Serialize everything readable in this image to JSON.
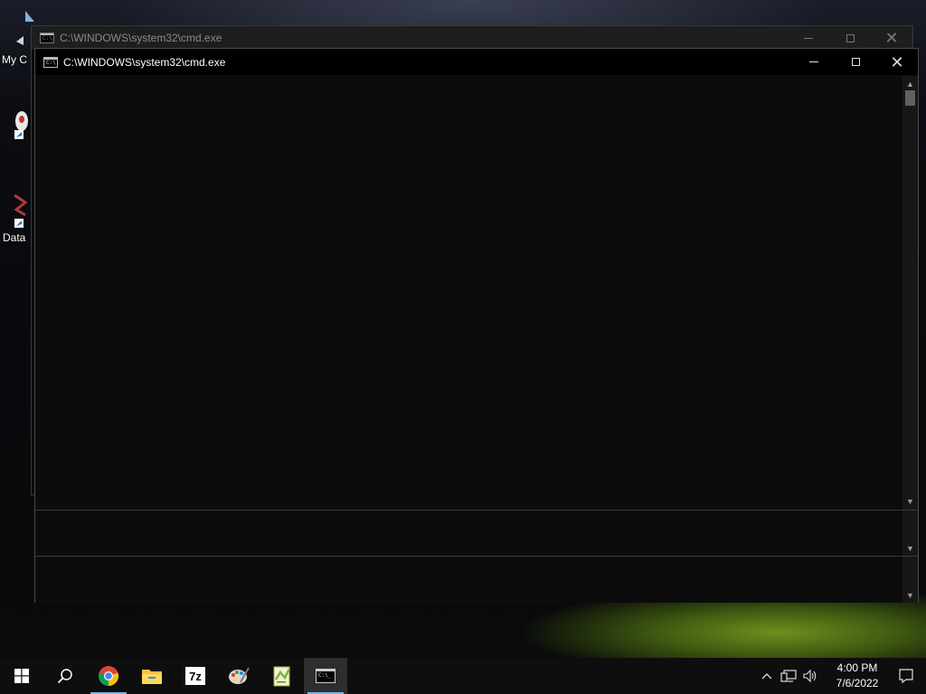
{
  "desktop": {
    "icons": [
      {
        "label": "My C",
        "icon": "this-pc-icon"
      },
      {
        "label": "",
        "icon": "app-shortcut-icon"
      },
      {
        "label": "Data",
        "icon": "data-shortcut-icon"
      }
    ]
  },
  "back_window": {
    "title": "C:\\WINDOWS\\system32\\cmd.exe"
  },
  "front_window": {
    "title": "C:\\WINDOWS\\system32\\cmd.exe",
    "icon_text": "C:\\."
  },
  "taskbar": {
    "items": [
      {
        "name": "start",
        "icon": "windows-logo-icon"
      },
      {
        "name": "search",
        "icon": "search-icon"
      },
      {
        "name": "chrome",
        "icon": "chrome-icon"
      },
      {
        "name": "file-explorer",
        "icon": "folder-icon"
      },
      {
        "name": "7zip",
        "icon": "7zip-icon",
        "label": "7z"
      },
      {
        "name": "paint",
        "icon": "paint-palette-icon"
      },
      {
        "name": "notepad-plus",
        "icon": "notepad-icon"
      },
      {
        "name": "cmd",
        "icon": "cmd-icon"
      }
    ],
    "clock_time": "4:00 PM",
    "clock_date": "7/6/2022"
  },
  "colors": {
    "accent": "#76b9ed",
    "console_bg": "#0c0c0c",
    "taskbar_bg": "#0e0e0e"
  }
}
